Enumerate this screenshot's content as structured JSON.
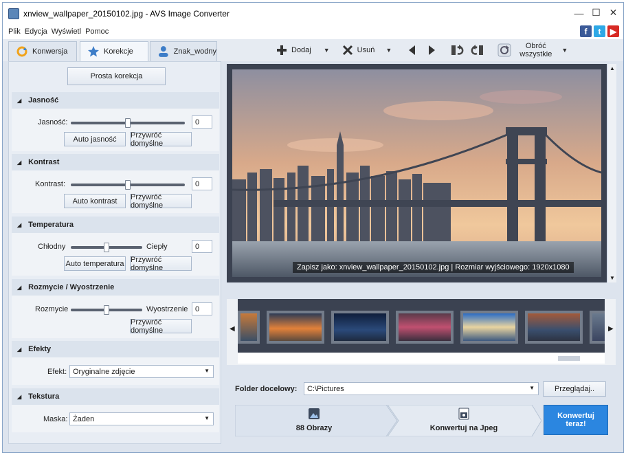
{
  "window": {
    "title": "xnview_wallpaper_20150102.jpg - AVS Image Converter"
  },
  "menu": [
    "Plik",
    "Edycja",
    "Wyświetl",
    "Pomoc"
  ],
  "tabs": [
    {
      "label": "Konwersja",
      "icon": "convert-icon"
    },
    {
      "label": "Korekcje",
      "icon": "star-icon"
    },
    {
      "label": "Znak_wodny",
      "icon": "person-icon"
    }
  ],
  "toolbar": {
    "add_label": "Dodaj",
    "remove_label": "Usuń",
    "rotate_all_line1": "Obróć",
    "rotate_all_line2": "wszystkie"
  },
  "left": {
    "simple_button": "Prosta korekcja",
    "sections": {
      "brightness": {
        "title": "Jasność",
        "label": "Jasność:",
        "value": "0",
        "level": 0.5,
        "auto": "Auto jasność",
        "reset": "Przywróć domyślne"
      },
      "contrast": {
        "title": "Kontrast",
        "label": "Kontrast:",
        "value": "0",
        "level": 0.5,
        "auto": "Auto kontrast",
        "reset": "Przywróć domyślne"
      },
      "temperature": {
        "title": "Temperatura",
        "left_label": "Chłodny",
        "right_label": "Ciepły",
        "value": "0",
        "level": 0.5,
        "auto": "Auto temperatura",
        "reset": "Przywróć domyślne"
      },
      "blur": {
        "title": "Rozmycie / Wyostrzenie",
        "left_label": "Rozmycie",
        "right_label": "Wyostrzenie",
        "value": "0",
        "level": 0.5,
        "reset": "Przywróć domyślne"
      },
      "effects": {
        "title": "Efekty",
        "label": "Efekt:",
        "selected": "Oryginalne zdjęcie"
      },
      "texture": {
        "title": "Tekstura",
        "label": "Maska:",
        "selected": "Żaden"
      }
    }
  },
  "preview": {
    "caption": "Zapisz jako: xnview_wallpaper_20150102.jpg | Rozmiar wyjściowego: 1920x1080"
  },
  "output": {
    "folder_label": "Folder docelowy:",
    "folder_value": "C:\\Pictures",
    "browse": "Przeglądaj..",
    "count_label": "88 Obrazy",
    "convert_to": "Konwertuj na Jpeg",
    "convert_now_line1": "Konwertuj",
    "convert_now_line2": "teraz!"
  },
  "colors": {
    "accent": "#2b86e0",
    "panel": "#e8edf4",
    "dark": "#3b4251"
  }
}
